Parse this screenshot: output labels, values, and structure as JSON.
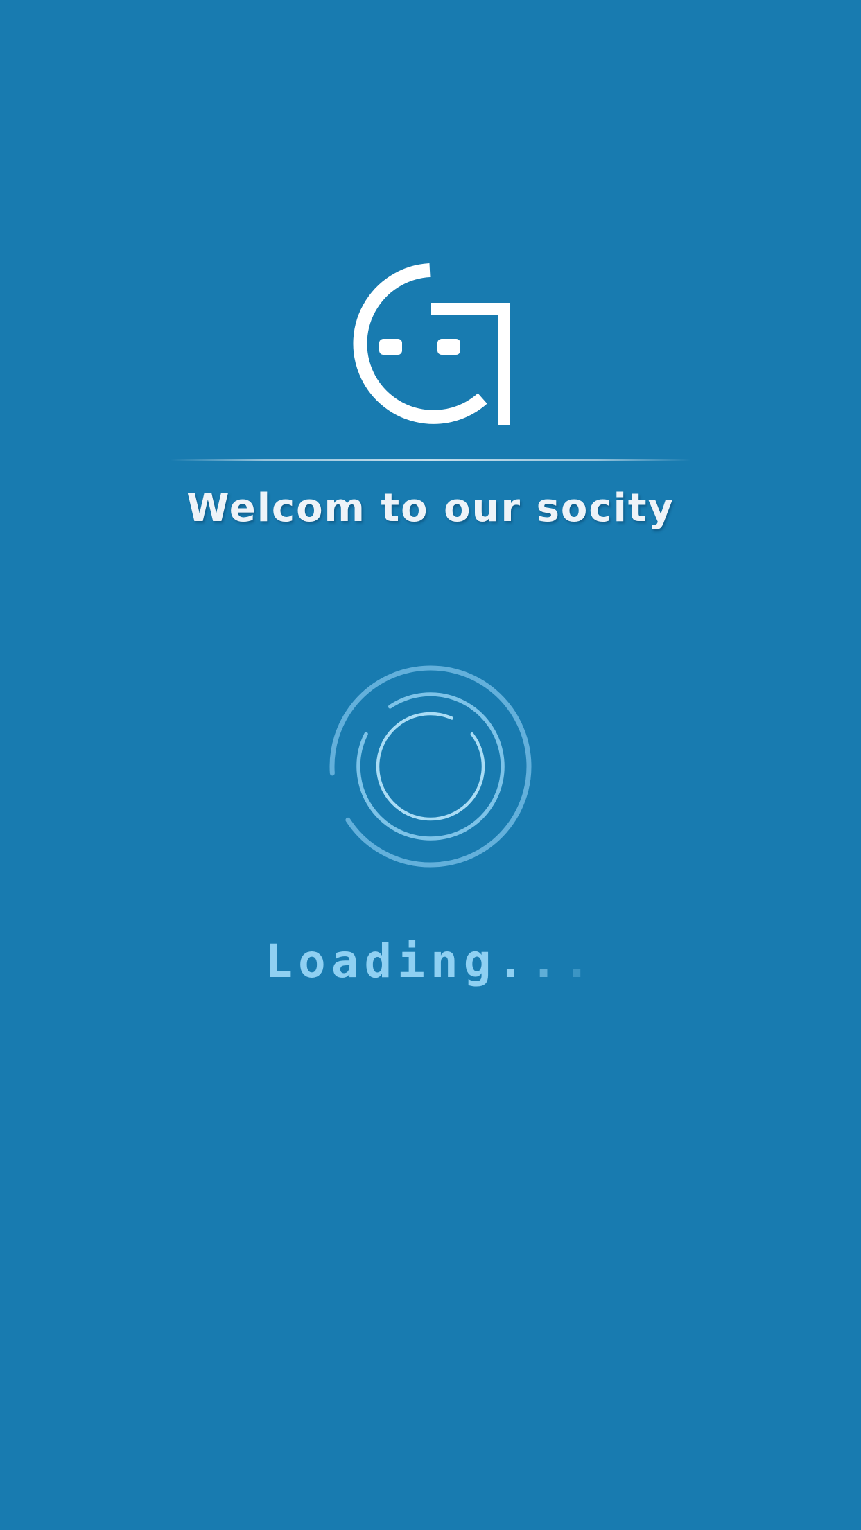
{
  "splash": {
    "welcome_text": "Welcom to our socity",
    "loading_word": "Loading",
    "loading_dots": [
      "."
    ]
  },
  "colors": {
    "background": "#187bb0",
    "logo": "#ffffff",
    "welcome_text": "#eef3f8",
    "spinner": "#8fd0f2",
    "loading_text": "#8fd0f2"
  },
  "icons": {
    "logo": "smiley-face-logo-icon",
    "spinner": "loading-spinner-icon"
  }
}
